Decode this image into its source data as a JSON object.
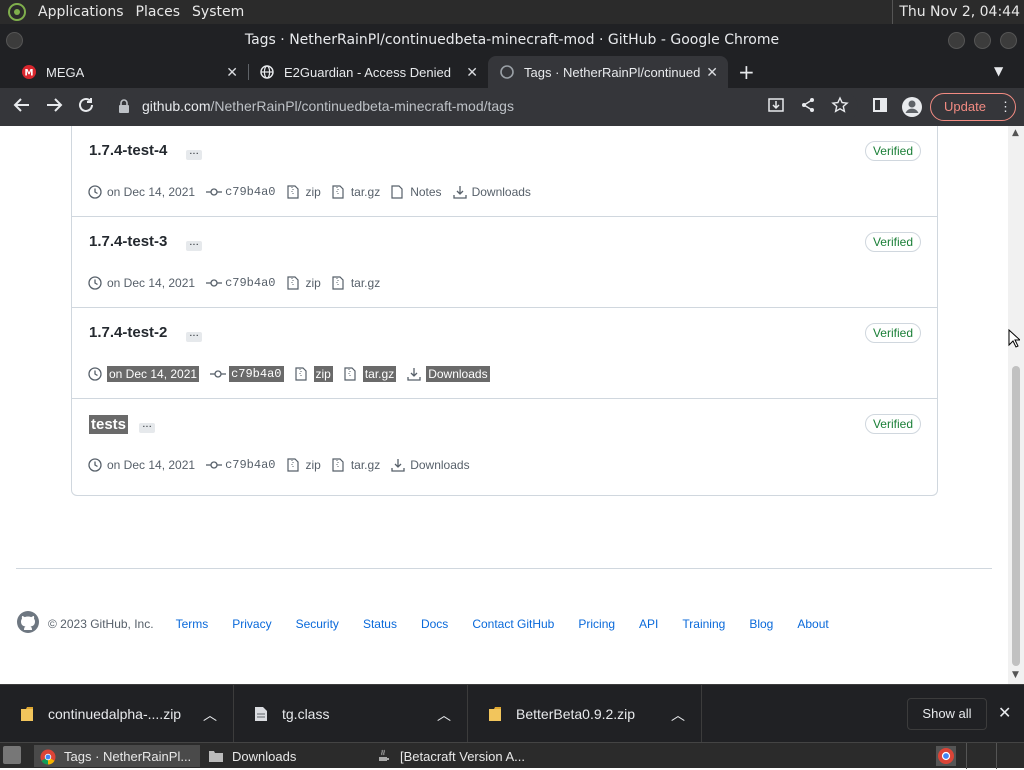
{
  "top_panel": {
    "menus": [
      "Applications",
      "Places",
      "System"
    ],
    "clock": "Thu Nov 2, 04:44"
  },
  "window": {
    "title": "Tags · NetherRainPl/continuedbeta-minecraft-mod · GitHub - Google Chrome"
  },
  "tabs": [
    {
      "label": "MEGA",
      "icon": "mega-icon",
      "active": false
    },
    {
      "label": "E2Guardian - Access Denied",
      "icon": "globe-icon",
      "active": false
    },
    {
      "label": "Tags · NetherRainPl/continued",
      "icon": "github-icon",
      "active": true
    }
  ],
  "omnibox": {
    "host": "github.com",
    "path": "/NetherRainPl/continuedbeta-minecraft-mod/tags"
  },
  "toolbar": {
    "update_label": "Update"
  },
  "tags": [
    {
      "name": "1.7.4-test-4",
      "verified": "Verified",
      "date": "on Dec 14, 2021",
      "commit": "c79b4a0",
      "zip": "zip",
      "targz": "tar.gz",
      "notes": "Notes",
      "downloads": "Downloads"
    },
    {
      "name": "1.7.4-test-3",
      "verified": "Verified",
      "date": "on Dec 14, 2021",
      "commit": "c79b4a0",
      "zip": "zip",
      "targz": "tar.gz"
    },
    {
      "name": "1.7.4-test-2",
      "verified": "Verified",
      "date": "on Dec 14, 2021",
      "commit": "c79b4a0",
      "zip": "zip",
      "targz": "tar.gz",
      "downloads": "Downloads"
    },
    {
      "name": "tests",
      "verified": "Verified",
      "date": "on Dec 14, 2021",
      "commit": "c79b4a0",
      "zip": "zip",
      "targz": "tar.gz",
      "downloads": "Downloads"
    }
  ],
  "footer": {
    "copyright": "© 2023 GitHub, Inc.",
    "links": [
      "Terms",
      "Privacy",
      "Security",
      "Status",
      "Docs",
      "Contact GitHub",
      "Pricing",
      "API",
      "Training",
      "Blog",
      "About"
    ]
  },
  "downloads": {
    "items": [
      "continuedalpha-....zip",
      "tg.class",
      "BetterBeta0.9.2.zip"
    ],
    "show_all": "Show all"
  },
  "taskbar": {
    "items": [
      "Tags · NetherRainPl...",
      "Downloads",
      "[Betacraft Version A..."
    ]
  },
  "colors": {
    "verified_green": "#1a7f37",
    "link_blue": "#0969da",
    "update_red": "#f28b82",
    "chrome_dark": "#202124"
  }
}
